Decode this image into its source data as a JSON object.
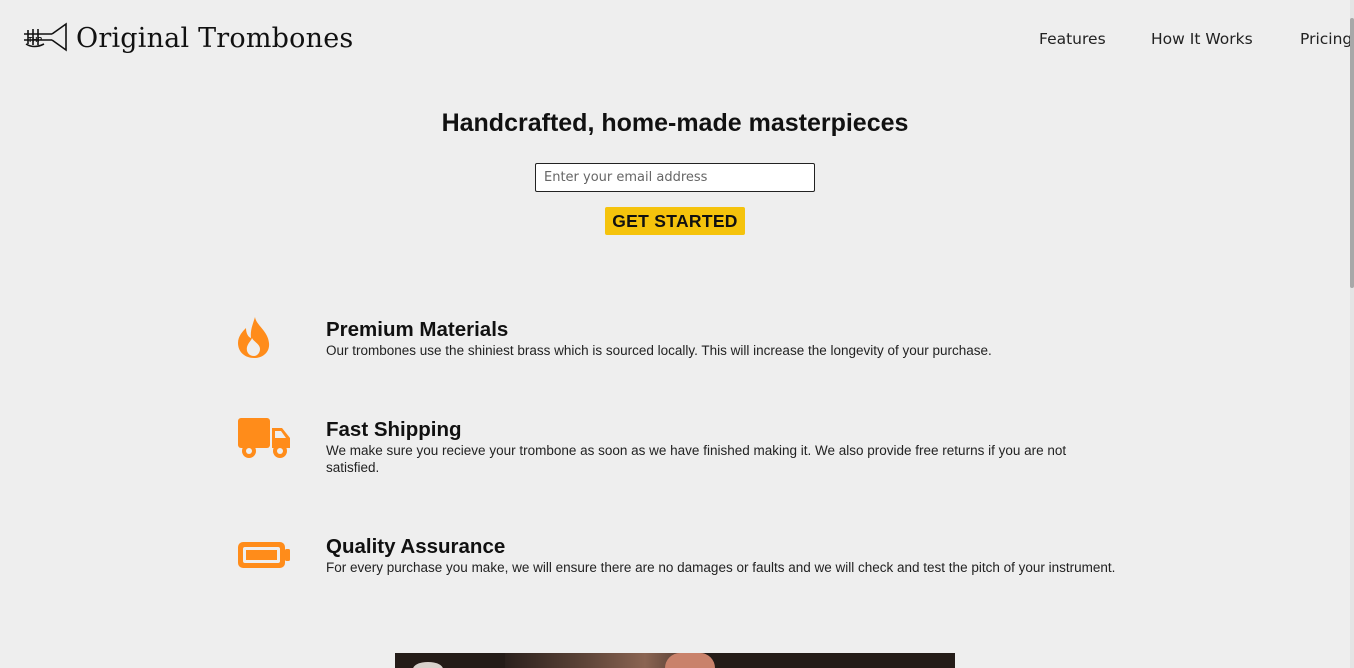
{
  "header": {
    "brand": "Original Trombones",
    "nav": {
      "features": "Features",
      "how_it_works": "How It Works",
      "pricing": "Pricing"
    }
  },
  "hero": {
    "title": "Handcrafted, home-made masterpieces",
    "email_placeholder": "Enter your email address",
    "cta_label": "GET STARTED"
  },
  "features": [
    {
      "icon": "fire-icon",
      "title": "Premium Materials",
      "description": "Our trombones use the shiniest brass which is sourced locally. This will increase the longevity of your purchase."
    },
    {
      "icon": "truck-icon",
      "title": "Fast Shipping",
      "description": "We make sure you recieve your trombone as soon as we have finished making it. We also provide free returns if you are not satisfied."
    },
    {
      "icon": "battery-icon",
      "title": "Quality Assurance",
      "description": "For every purchase you make, we will ensure there are no damages or faults and we will check and test the pitch of your instrument."
    }
  ],
  "colors": {
    "background": "#eeeeee",
    "accent_button": "#f5c30c",
    "icon_orange": "#ff8c1a"
  }
}
